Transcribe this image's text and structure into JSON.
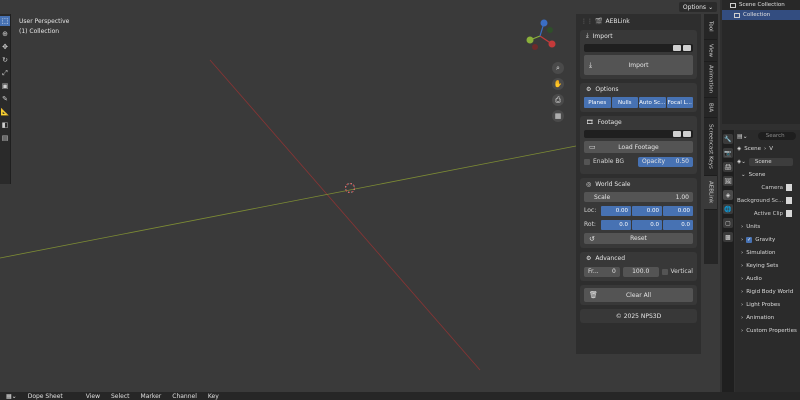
{
  "viewport": {
    "mode": "User Perspective",
    "collection": "(1) Collection",
    "options_label": "Options"
  },
  "npanel": {
    "title": "AEBLink",
    "import": {
      "header": "Import",
      "button": "Import"
    },
    "options": {
      "header": "Options",
      "toggles": [
        "Planes",
        "Nulls",
        "Auto Sc...",
        "Focal L..."
      ]
    },
    "footage": {
      "header": "Footage",
      "button": "Load Footage",
      "enable_bg": "Enable BG",
      "opacity_label": "Opacity",
      "opacity_value": "0.50"
    },
    "world_scale": {
      "header": "World Scale",
      "scale_label": "Scale",
      "scale_value": "1.00",
      "loc_label": "Loc:",
      "loc": [
        "0.00",
        "0.00",
        "0.00"
      ],
      "rot_label": "Rot:",
      "rot": [
        "0.0",
        "0.0",
        "0.0"
      ],
      "reset": "Reset"
    },
    "advanced": {
      "header": "Advanced",
      "frame_label": "Fr...",
      "frame_value": "0",
      "value": "100.0",
      "vertical": "Vertical"
    },
    "clear_all": "Clear All",
    "copyright": "© 2025 NPS3D"
  },
  "vtabs": [
    "Tool",
    "View",
    "Animation",
    "BlA",
    "Screencast Keys",
    "AEBLink"
  ],
  "outliner": {
    "root": "Scene Collection",
    "child": "Collection"
  },
  "properties": {
    "search_placeholder": "Search",
    "scene_name": "Scene",
    "view_layer": "V",
    "section": "Scene",
    "camera": "Camera",
    "background": "Background Sc...",
    "active_clip": "Active Clip",
    "panels": [
      "Units",
      "Gravity",
      "Simulation",
      "Keying Sets",
      "Audio",
      "Rigid Body World",
      "Light Probes",
      "Animation",
      "Custom Properties"
    ]
  },
  "timeline": {
    "editor": "Dope Sheet",
    "menus": [
      "View",
      "Select",
      "Marker",
      "Channel",
      "Key"
    ]
  },
  "colors": {
    "accent": "#4772b3",
    "x_axis": "#a33a3a",
    "y_axis": "#8a9a3a"
  }
}
